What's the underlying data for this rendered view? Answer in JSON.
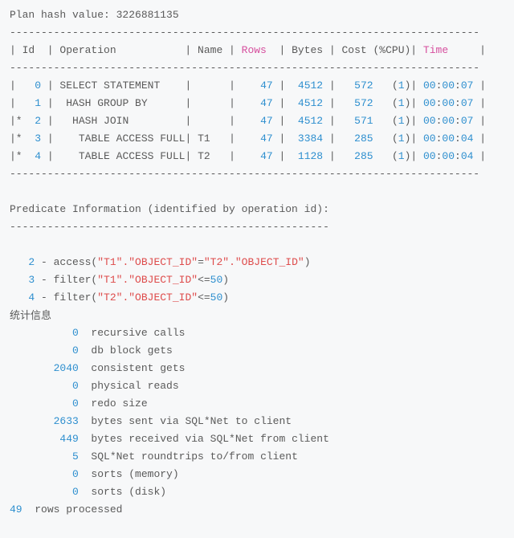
{
  "plan_hash_line": "Plan hash value: 3226881135",
  "hr": "---------------------------------------------------------------------------",
  "hdr": {
    "prefix": "| Id  | Operation           | Name | ",
    "rows": "Rows",
    "mid": "  | Bytes | Cost (%CPU)| ",
    "time": "Time",
    "suffix": "     |"
  },
  "rows": [
    {
      "p": "|   ",
      "id": "0",
      "op": " | SELECT STATEMENT    |      |    ",
      "r": "47",
      "b1": " |  ",
      "bytes": "4512",
      "b2": " |   ",
      "cost": "572",
      "b3": "   (",
      "cpu": "1",
      "b4": ")| ",
      "h": "00",
      "m": "00",
      "s": "07",
      "t": " |"
    },
    {
      "p": "|   ",
      "id": "1",
      "op": " |  HASH GROUP BY      |      |    ",
      "r": "47",
      "b1": " |  ",
      "bytes": "4512",
      "b2": " |   ",
      "cost": "572",
      "b3": "   (",
      "cpu": "1",
      "b4": ")| ",
      "h": "00",
      "m": "00",
      "s": "07",
      "t": " |"
    },
    {
      "p": "|*  ",
      "id": "2",
      "op": " |   HASH JOIN         |      |    ",
      "r": "47",
      "b1": " |  ",
      "bytes": "4512",
      "b2": " |   ",
      "cost": "571",
      "b3": "   (",
      "cpu": "1",
      "b4": ")| ",
      "h": "00",
      "m": "00",
      "s": "07",
      "t": " |"
    },
    {
      "p": "|*  ",
      "id": "3",
      "op": " |    TABLE ACCESS FULL| T1   |    ",
      "r": "47",
      "b1": " |  ",
      "bytes": "3384",
      "b2": " |   ",
      "cost": "285",
      "b3": "   (",
      "cpu": "1",
      "b4": ")| ",
      "h": "00",
      "m": "00",
      "s": "04",
      "t": " |"
    },
    {
      "p": "|*  ",
      "id": "4",
      "op": " |    TABLE ACCESS FULL| T2   |    ",
      "r": "47",
      "b1": " |  ",
      "bytes": "1128",
      "b2": " |   ",
      "cost": "285",
      "b3": "   (",
      "cpu": "1",
      "b4": ")| ",
      "h": "00",
      "m": "00",
      "s": "04",
      "t": " |"
    }
  ],
  "pred_title": "Predicate Information (identified by operation id):",
  "pred_hr": "---------------------------------------------------",
  "preds": [
    {
      "id": "2",
      "kind": "access",
      "l": "\"T1\".\"OBJECT_ID\"",
      "op": "=",
      "r": "\"T2\".\"OBJECT_ID\""
    },
    {
      "id": "3",
      "kind": "filter",
      "l": "\"T1\".\"OBJECT_ID\"",
      "op": "<=",
      "r": "50"
    },
    {
      "id": "4",
      "kind": "filter",
      "l": "\"T2\".\"OBJECT_ID\"",
      "op": "<=",
      "r": "50"
    }
  ],
  "stats_label": "统计信息",
  "stats": [
    {
      "n": "0",
      "pad": "          ",
      "t": "  recursive calls"
    },
    {
      "n": "0",
      "pad": "          ",
      "t": "  db block gets"
    },
    {
      "n": "2040",
      "pad": "       ",
      "t": "  consistent gets"
    },
    {
      "n": "0",
      "pad": "          ",
      "t": "  physical reads"
    },
    {
      "n": "0",
      "pad": "          ",
      "t": "  redo size"
    },
    {
      "n": "2633",
      "pad": "       ",
      "t": "  bytes sent via SQL*Net to client"
    },
    {
      "n": "449",
      "pad": "        ",
      "t": "  bytes received via SQL*Net from client"
    },
    {
      "n": "5",
      "pad": "          ",
      "t": "  SQL*Net roundtrips to/from client"
    },
    {
      "n": "0",
      "pad": "          ",
      "t": "  sorts (memory)"
    },
    {
      "n": "0",
      "pad": "          ",
      "t": "  sorts (disk)"
    }
  ],
  "footer": {
    "n": "49",
    "t": "  rows processed"
  }
}
